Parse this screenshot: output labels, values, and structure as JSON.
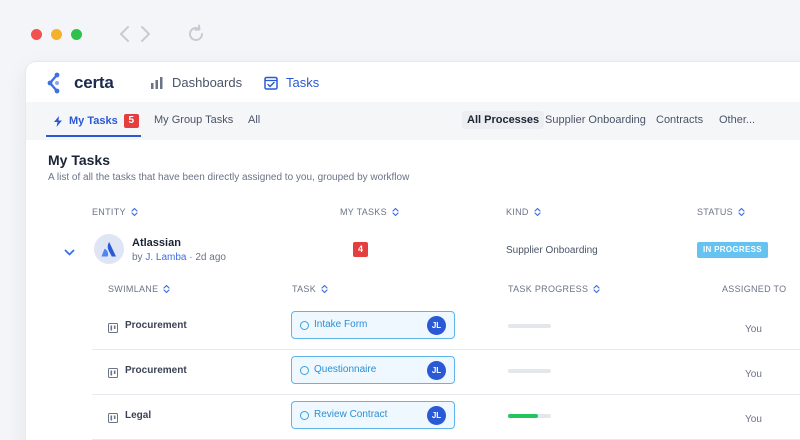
{
  "browser": {
    "traffic_lights": [
      "#f2514d",
      "#f6b128",
      "#2fc24a"
    ]
  },
  "app": {
    "name": "certa",
    "brand_color": "#3f6fe0"
  },
  "topnav": {
    "dashboards": "Dashboards",
    "tasks": "Tasks"
  },
  "tabs": {
    "my_tasks": "My Tasks",
    "my_tasks_count": "5",
    "group_tasks": "My Group Tasks",
    "all": "All"
  },
  "processes": {
    "all": "All Processes",
    "supplier": "Supplier Onboarding",
    "contracts": "Contracts",
    "other": "Other..."
  },
  "page": {
    "title": "My Tasks",
    "subtitle": "A list of all the tasks that have been directly assigned to you, grouped by workflow"
  },
  "columns": {
    "entity": "ENTITY",
    "my_tasks": "MY TASKS",
    "kind": "KIND",
    "status": "STATUS"
  },
  "entity": {
    "name": "Atlassian",
    "by": "by",
    "owner": "J. Lamba",
    "age": "· 2d ago",
    "task_count": "4",
    "kind": "Supplier Onboarding",
    "status": "IN PROGRESS",
    "status_color": "#66c2ef"
  },
  "subcolumns": {
    "swimlane": "SWIMLANE",
    "task": "TASK",
    "progress": "TASK PROGRESS",
    "assigned": "ASSIGNED TO"
  },
  "tasks": [
    {
      "swimlane": "Procurement",
      "task": "Intake Form",
      "assignee_initials": "JL",
      "progress": 0,
      "assigned_to": "You"
    },
    {
      "swimlane": "Procurement",
      "task": "Questionnaire",
      "assignee_initials": "JL",
      "progress": 0,
      "assigned_to": "You"
    },
    {
      "swimlane": "Legal",
      "task": "Review Contract",
      "assignee_initials": "JL",
      "progress": 0.7,
      "assigned_to": "You"
    }
  ]
}
